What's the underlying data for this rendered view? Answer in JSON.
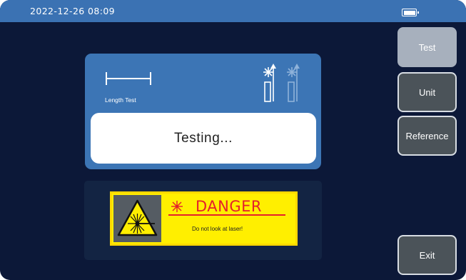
{
  "status_bar": {
    "datetime": "2022-12-26  08:09",
    "battery_level": 1.0
  },
  "test_panel": {
    "mode_label": "Length Test",
    "status_text": "Testing..."
  },
  "warning": {
    "title": "DANGER",
    "subtitle": "Do not look at laser!"
  },
  "side_menu": {
    "buttons": [
      {
        "label": "Test",
        "active": true
      },
      {
        "label": "Unit",
        "active": false
      },
      {
        "label": "Reference",
        "active": false
      },
      {
        "label": "Exit",
        "active": false
      }
    ]
  },
  "colors": {
    "background": "#0c1838",
    "status_bar": "#3b72b3",
    "test_panel": "#3c75b5",
    "active_button": "#a7b0bd",
    "button": "#4b5359",
    "danger_red": "#e4202c",
    "danger_yellow": "#ffee00"
  }
}
